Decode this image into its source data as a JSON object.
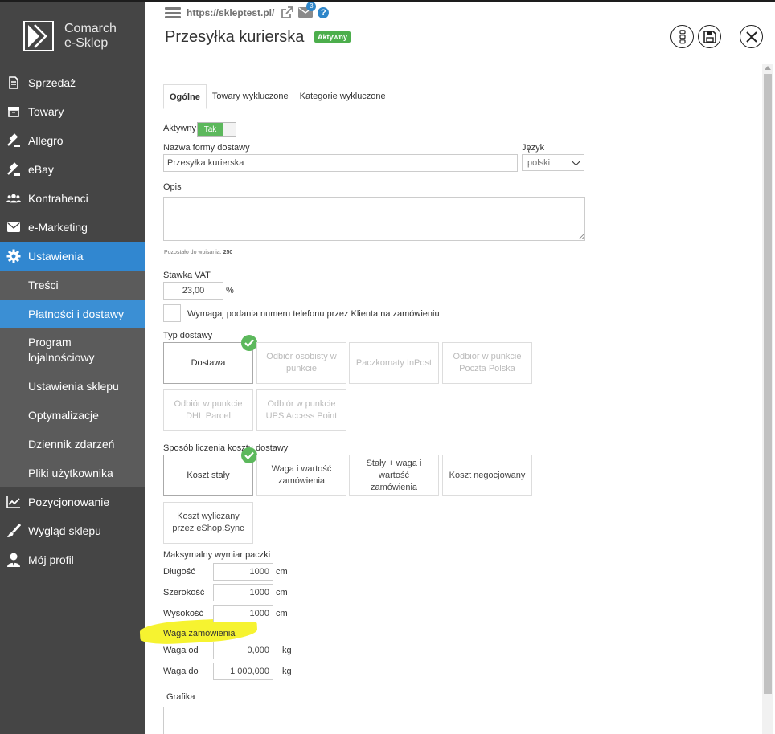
{
  "app": {
    "brand_line1": "Comarch",
    "brand_line2": "e-Sklep"
  },
  "sidebar": {
    "items": [
      {
        "label": "Sprzedaż",
        "icon": "document-icon"
      },
      {
        "label": "Towary",
        "icon": "box-icon"
      },
      {
        "label": "Allegro",
        "icon": "gavel-icon"
      },
      {
        "label": "eBay",
        "icon": "gavel-icon"
      },
      {
        "label": "Kontrahenci",
        "icon": "users-icon"
      },
      {
        "label": "e-Marketing",
        "icon": "envelope-icon"
      },
      {
        "label": "Ustawienia",
        "icon": "gear-icon"
      },
      {
        "label": "Pozycjonowanie",
        "icon": "chart-line-icon"
      },
      {
        "label": "Wygląd sklepu",
        "icon": "brush-icon"
      },
      {
        "label": "Mój profil",
        "icon": "user-icon"
      }
    ],
    "subitems": [
      {
        "label": "Treści"
      },
      {
        "label": "Płatności i dostawy"
      },
      {
        "label": "Program lojalnościowy"
      },
      {
        "label": "Ustawienia sklepu"
      },
      {
        "label": "Optymalizacje"
      },
      {
        "label": "Dziennik zdarzeń"
      },
      {
        "label": "Pliki użytkownika"
      }
    ]
  },
  "header": {
    "url": "https://skleptest.pl/",
    "mail_count": "3",
    "help": "?",
    "title": "Przesyłka kurierska",
    "status_badge": "Aktywny"
  },
  "tabs": [
    "Ogólne",
    "Towary wykluczone",
    "Kategorie wykluczone"
  ],
  "form": {
    "active_label": "Aktywny",
    "active_value": "Tak",
    "name_label": "Nazwa formy dostawy",
    "name_value": "Przesyłka kurierska",
    "language_label": "Język",
    "language_value": "polski",
    "description_label": "Opis",
    "remaining_label": "Pozostało do wpisania:",
    "remaining_value": "250",
    "vat_label": "Stawka VAT",
    "vat_value": "23,00",
    "vat_unit": "%",
    "phone_checkbox_label": "Wymagaj podania numeru telefonu przez Klienta na zamówieniu",
    "delivery_type_label": "Typ dostawy",
    "delivery_types": [
      "Dostawa",
      "Odbiór osobisty w punkcie",
      "Paczkomaty InPost",
      "Odbiór w punkcie Poczta Polska",
      "Odbiór w punkcie DHL Parcel",
      "Odbiór w punkcie UPS Access Point"
    ],
    "cost_method_label": "Sposób liczenia kosztu dostawy",
    "cost_methods": [
      "Koszt stały",
      "Waga i wartość zamówienia",
      "Stały + waga i wartość zamówienia",
      "Koszt negocjowany",
      "Koszt wyliczany przez eShop.Sync"
    ],
    "max_dim_label": "Maksymalny wymiar paczki",
    "length_label": "Długość",
    "length_value": "1000",
    "width_label": "Szerokość",
    "width_value": "1000",
    "height_label": "Wysokość",
    "height_value": "1000",
    "dim_unit": "cm",
    "weight_label": "Waga zamówienia",
    "weight_from_label": "Waga od",
    "weight_from_value": "0,000",
    "weight_to_label": "Waga do",
    "weight_to_value": "1 000,000",
    "weight_unit": "kg",
    "graphic_label": "Grafika"
  },
  "colors": {
    "sidebar": "#454545",
    "active": "#3187d0",
    "success": "#5cb85c",
    "highlight": "#f6f330"
  }
}
